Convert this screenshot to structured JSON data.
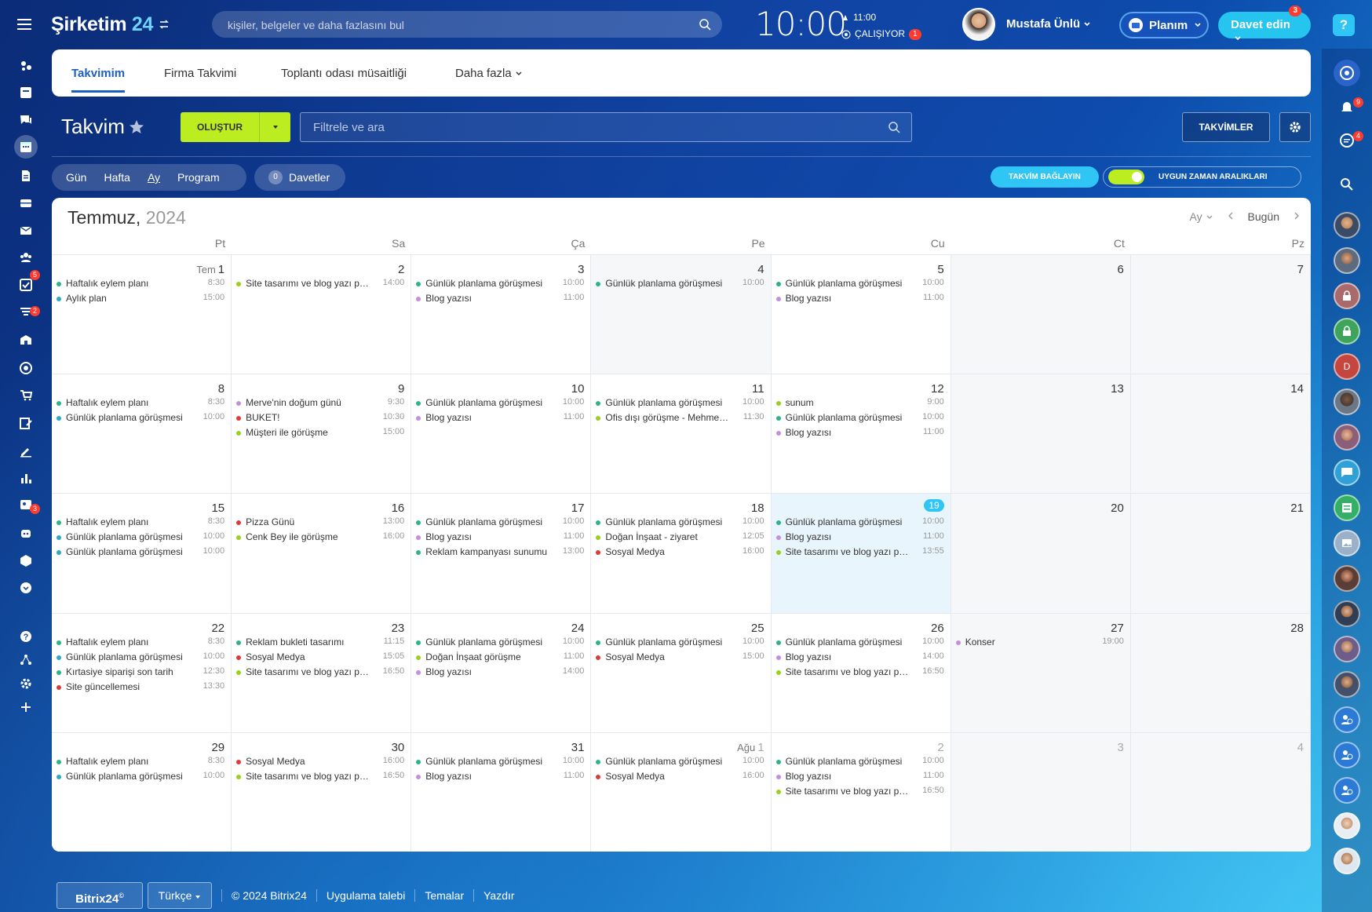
{
  "header": {
    "brand_name": "Şirketim",
    "brand_num": "24",
    "search_placeholder": "kişiler, belgeler ve daha fazlasını bul",
    "clock": "10:00",
    "clock_alarm": "11:00",
    "work_status": "ÇALIŞIYOR",
    "work_status_count": "1",
    "user_name": "Mustafa Ünlü",
    "plan_label": "Planım",
    "invite_label": "Davet edin",
    "invite_badge": "3",
    "help": "?"
  },
  "left_sidebar": {
    "icons": [
      "feed-icon",
      "tasks-icon",
      "chat-icon",
      "calendar-icon",
      "documents-icon",
      "drive-icon",
      "mail-icon",
      "groups-icon",
      "checklist-icon",
      "filter-icon",
      "company-icon",
      "target-icon",
      "shop-icon",
      "edit-icon",
      "sign-icon",
      "analytics-icon",
      "contacts-icon",
      "robot-icon",
      "box-icon",
      "more-icon",
      "help-icon",
      "network-icon",
      "settings-icon",
      "add-icon"
    ],
    "badges": {
      "checklist": "5",
      "filter": "2",
      "contacts": "3"
    }
  },
  "right_sidebar": {
    "badges": {
      "notifications": "9",
      "messages": "4"
    }
  },
  "tabs": [
    {
      "label": "Takvimim",
      "active": true
    },
    {
      "label": "Firma Takvimi",
      "active": false
    },
    {
      "label": "Toplantı odası müsaitliği",
      "active": false
    },
    {
      "label": "Daha fazla",
      "active": false
    }
  ],
  "toolbar": {
    "title": "Takvim",
    "create_label": "OLUŞTUR",
    "filter_placeholder": "Filtrele ve ara",
    "calendars_label": "TAKVİMLER",
    "views": [
      "Gün",
      "Hafta",
      "Ay",
      "Program"
    ],
    "selected_view": "Ay",
    "invites_count": "0",
    "invites_label": "Davetler",
    "connect_label": "TAKVİM BAĞLAYIN",
    "slots_label": "UYGUN ZAMAN ARALIKLARI"
  },
  "calendar": {
    "month": "Temmuz,",
    "year": "2024",
    "view_select": "Ay",
    "today_label": "Bugün",
    "weekdays": [
      "Pt",
      "Sa",
      "Ça",
      "Pe",
      "Cu",
      "Ct",
      "Pz"
    ],
    "colors": {
      "green": "#2db38a",
      "purple": "#c48fdc",
      "lime": "#9ccf1e",
      "red": "#dd3b3b",
      "teal": "#2fa7c9"
    },
    "weeks": [
      [
        {
          "day": "1",
          "prefix": "Tem",
          "events": [
            {
              "title": "Haftalık eylem planı",
              "time": "8:30",
              "color": "green"
            },
            {
              "title": "Aylık plan",
              "time": "15:00",
              "color": "teal"
            }
          ]
        },
        {
          "day": "2",
          "events": [
            {
              "title": "Site tasarımı ve blog yazı planı",
              "time": "14:00",
              "color": "lime"
            }
          ]
        },
        {
          "day": "3",
          "events": [
            {
              "title": "Günlük planlama görüşmesi",
              "time": "10:00",
              "color": "green"
            },
            {
              "title": "Blog yazısı",
              "time": "11:00",
              "color": "purple"
            }
          ]
        },
        {
          "day": "4",
          "weekend": true,
          "events": [
            {
              "title": "Günlük planlama görüşmesi",
              "time": "10:00",
              "color": "green"
            }
          ]
        },
        {
          "day": "5",
          "events": [
            {
              "title": "Günlük planlama görüşmesi",
              "time": "10:00",
              "color": "green"
            },
            {
              "title": "Blog yazısı",
              "time": "11:00",
              "color": "purple"
            }
          ]
        },
        {
          "day": "6",
          "weekend": true,
          "events": []
        },
        {
          "day": "7",
          "weekend": true,
          "events": []
        }
      ],
      [
        {
          "day": "8",
          "events": [
            {
              "title": "Haftalık eylem planı",
              "time": "8:30",
              "color": "green"
            },
            {
              "title": "Günlük planlama görüşmesi",
              "time": "10:00",
              "color": "teal"
            }
          ]
        },
        {
          "day": "9",
          "events": [
            {
              "title": "Merve'nin doğum günü",
              "time": "9:30",
              "color": "purple"
            },
            {
              "title": "BUKET!",
              "time": "10:30",
              "color": "red"
            },
            {
              "title": "Müşteri ile görüşme",
              "time": "15:00",
              "color": "lime"
            }
          ]
        },
        {
          "day": "10",
          "events": [
            {
              "title": "Günlük planlama görüşmesi",
              "time": "10:00",
              "color": "green"
            },
            {
              "title": "Blog yazısı",
              "time": "11:00",
              "color": "purple"
            }
          ]
        },
        {
          "day": "11",
          "events": [
            {
              "title": "Günlük planlama görüşmesi",
              "time": "10:00",
              "color": "green"
            },
            {
              "title": "Ofis dışı görüşme - Mehmet Bey",
              "time": "11:30",
              "color": "lime"
            }
          ]
        },
        {
          "day": "12",
          "events": [
            {
              "title": "sunum",
              "time": "9:00",
              "color": "lime"
            },
            {
              "title": "Günlük planlama görüşmesi",
              "time": "10:00",
              "color": "green"
            },
            {
              "title": "Blog yazısı",
              "time": "11:00",
              "color": "purple"
            }
          ]
        },
        {
          "day": "13",
          "weekend": true,
          "events": []
        },
        {
          "day": "14",
          "weekend": true,
          "events": []
        }
      ],
      [
        {
          "day": "15",
          "events": [
            {
              "title": "Haftalık eylem planı",
              "time": "8:30",
              "color": "green"
            },
            {
              "title": "Günlük planlama görüşmesi",
              "time": "10:00",
              "color": "teal"
            },
            {
              "title": "Günlük planlama görüşmesi",
              "time": "10:00",
              "color": "teal"
            }
          ]
        },
        {
          "day": "16",
          "events": [
            {
              "title": "Pizza Günü",
              "time": "13:00",
              "color": "red"
            },
            {
              "title": "Cenk Bey ile görüşme",
              "time": "16:00",
              "color": "lime"
            }
          ]
        },
        {
          "day": "17",
          "events": [
            {
              "title": "Günlük planlama görüşmesi",
              "time": "10:00",
              "color": "green"
            },
            {
              "title": "Blog yazısı",
              "time": "11:00",
              "color": "purple"
            },
            {
              "title": "Reklam kampanyası sunumu",
              "time": "13:00",
              "color": "green"
            }
          ]
        },
        {
          "day": "18",
          "events": [
            {
              "title": "Günlük planlama görüşmesi",
              "time": "10:00",
              "color": "green"
            },
            {
              "title": "Doğan İnşaat - ziyaret",
              "time": "12:05",
              "color": "lime"
            },
            {
              "title": "Sosyal Medya",
              "time": "16:00",
              "color": "red"
            }
          ]
        },
        {
          "day": "19",
          "today": true,
          "events": [
            {
              "title": "Günlük planlama görüşmesi",
              "time": "10:00",
              "color": "green"
            },
            {
              "title": "Blog yazısı",
              "time": "11:00",
              "color": "purple"
            },
            {
              "title": "Site tasarımı ve blog yazı planı",
              "time": "13:55",
              "color": "lime"
            }
          ]
        },
        {
          "day": "20",
          "weekend": true,
          "events": []
        },
        {
          "day": "21",
          "weekend": true,
          "events": []
        }
      ],
      [
        {
          "day": "22",
          "events": [
            {
              "title": "Haftalık eylem planı",
              "time": "8:30",
              "color": "green"
            },
            {
              "title": "Günlük planlama görüşmesi",
              "time": "10:00",
              "color": "teal"
            },
            {
              "title": "Kırtasiye siparişi son tarih",
              "time": "12:30",
              "color": "green"
            },
            {
              "title": "Site güncellemesi",
              "time": "13:30",
              "color": "red"
            }
          ]
        },
        {
          "day": "23",
          "events": [
            {
              "title": "Reklam bukleti tasarımı",
              "time": "11:15",
              "color": "green"
            },
            {
              "title": "Sosyal Medya",
              "time": "15:05",
              "color": "red"
            },
            {
              "title": "Site tasarımı ve blog yazı planı",
              "time": "16:50",
              "color": "lime"
            }
          ]
        },
        {
          "day": "24",
          "events": [
            {
              "title": "Günlük planlama görüşmesi",
              "time": "10:00",
              "color": "green"
            },
            {
              "title": "Doğan İnşaat görüşme",
              "time": "11:00",
              "color": "lime"
            },
            {
              "title": "Blog yazısı",
              "time": "14:00",
              "color": "purple"
            }
          ]
        },
        {
          "day": "25",
          "events": [
            {
              "title": "Günlük planlama görüşmesi",
              "time": "10:00",
              "color": "green"
            },
            {
              "title": "Sosyal Medya",
              "time": "15:00",
              "color": "red"
            }
          ]
        },
        {
          "day": "26",
          "events": [
            {
              "title": "Günlük planlama görüşmesi",
              "time": "10:00",
              "color": "green"
            },
            {
              "title": "Blog yazısı",
              "time": "14:00",
              "color": "purple"
            },
            {
              "title": "Site tasarımı ve blog yazı planı",
              "time": "16:50",
              "color": "lime"
            }
          ]
        },
        {
          "day": "27",
          "weekend": true,
          "events": [
            {
              "title": "Konser",
              "time": "19:00",
              "color": "purple"
            }
          ]
        },
        {
          "day": "28",
          "weekend": true,
          "events": []
        }
      ],
      [
        {
          "day": "29",
          "events": [
            {
              "title": "Haftalık eylem planı",
              "time": "8:30",
              "color": "green"
            },
            {
              "title": "Günlük planlama görüşmesi",
              "time": "10:00",
              "color": "teal"
            }
          ]
        },
        {
          "day": "30",
          "events": [
            {
              "title": "Sosyal Medya",
              "time": "16:00",
              "color": "red"
            },
            {
              "title": "Site tasarımı ve blog yazı planı",
              "time": "16:50",
              "color": "lime"
            }
          ]
        },
        {
          "day": "31",
          "events": [
            {
              "title": "Günlük planlama görüşmesi",
              "time": "10:00",
              "color": "green"
            },
            {
              "title": "Blog yazısı",
              "time": "11:00",
              "color": "purple"
            }
          ]
        },
        {
          "day": "1",
          "prefix": "Ağu",
          "othermonth": true,
          "events": [
            {
              "title": "Günlük planlama görüşmesi",
              "time": "10:00",
              "color": "green"
            },
            {
              "title": "Sosyal Medya",
              "time": "16:00",
              "color": "red"
            }
          ]
        },
        {
          "day": "2",
          "othermonth": true,
          "events": [
            {
              "title": "Günlük planlama görüşmesi",
              "time": "10:00",
              "color": "green"
            },
            {
              "title": "Blog yazısı",
              "time": "11:00",
              "color": "purple"
            },
            {
              "title": "Site tasarımı ve blog yazı planı",
              "time": "16:50",
              "color": "lime"
            }
          ]
        },
        {
          "day": "3",
          "weekend": true,
          "othermonth": true,
          "events": []
        },
        {
          "day": "4",
          "weekend": true,
          "othermonth": true,
          "events": []
        }
      ]
    ]
  },
  "footer": {
    "logo": "Bitrix24",
    "language": "Türkçe",
    "links": [
      "© 2024 Bitrix24",
      "Uygulama talebi",
      "Temalar",
      "Yazdır"
    ]
  }
}
